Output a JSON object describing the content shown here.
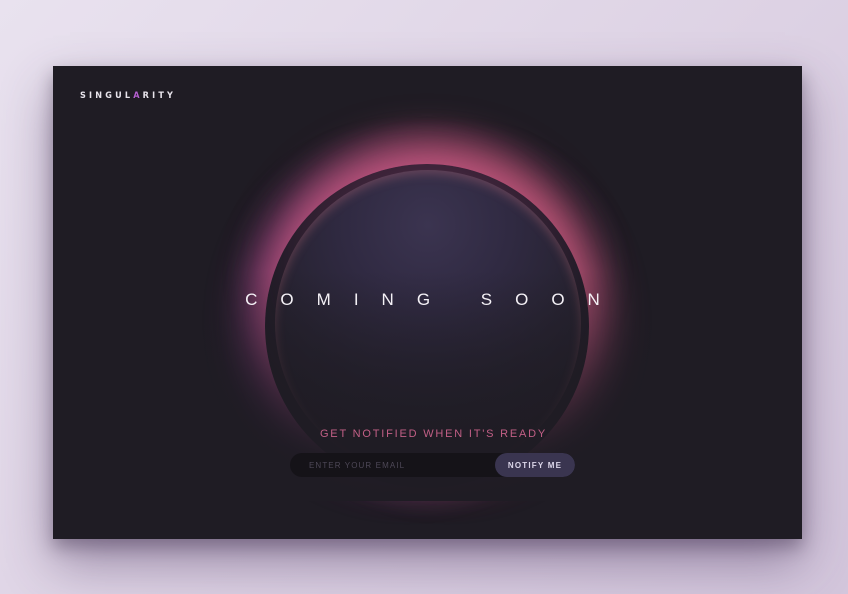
{
  "brand": {
    "logo_before": "SINGUL",
    "logo_accent": "A",
    "logo_after": "RITY",
    "accent_color": "#b55fd0"
  },
  "hero": {
    "headline": "COMING SOON",
    "glow_colors": [
      "#f06e82",
      "#963caa"
    ]
  },
  "signup": {
    "prompt": "GET NOTIFIED WHEN IT'S READY",
    "email_placeholder": "ENTER YOUR EMAIL",
    "email_value": "",
    "button_label": "NOTIFY ME",
    "prompt_color": "#c25f86"
  },
  "theme": {
    "card_background": "#1f1c24",
    "page_background": "#e3d9e9"
  }
}
